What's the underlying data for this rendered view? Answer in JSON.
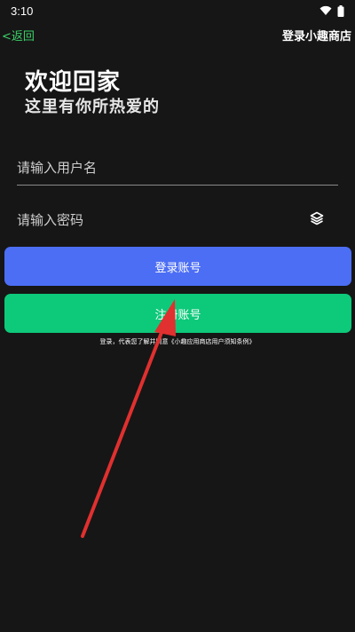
{
  "status_bar": {
    "time": "3:10",
    "icons": [
      "wifi-icon",
      "battery-icon"
    ]
  },
  "top_bar": {
    "back_label": "<返回",
    "title": "登录小趣商店",
    "back_color": "#3cd46a"
  },
  "welcome": {
    "title": "欢迎回家",
    "subtitle": "这里有你所热爱的"
  },
  "form": {
    "username_placeholder": "请输入用户名",
    "password_placeholder": "请输入密码",
    "password_toggle_icon": "layers-icon"
  },
  "buttons": {
    "login_label": "登录账号",
    "login_color": "#4c6ef5",
    "register_label": "注册账号",
    "register_color": "#0dc97a"
  },
  "agreement_text": "登录，代表您了解并同意《小趣应用商店用户须知条例》",
  "annotation": {
    "arrow_color": "#e0302f",
    "icon": "red-arrow-annotation"
  }
}
